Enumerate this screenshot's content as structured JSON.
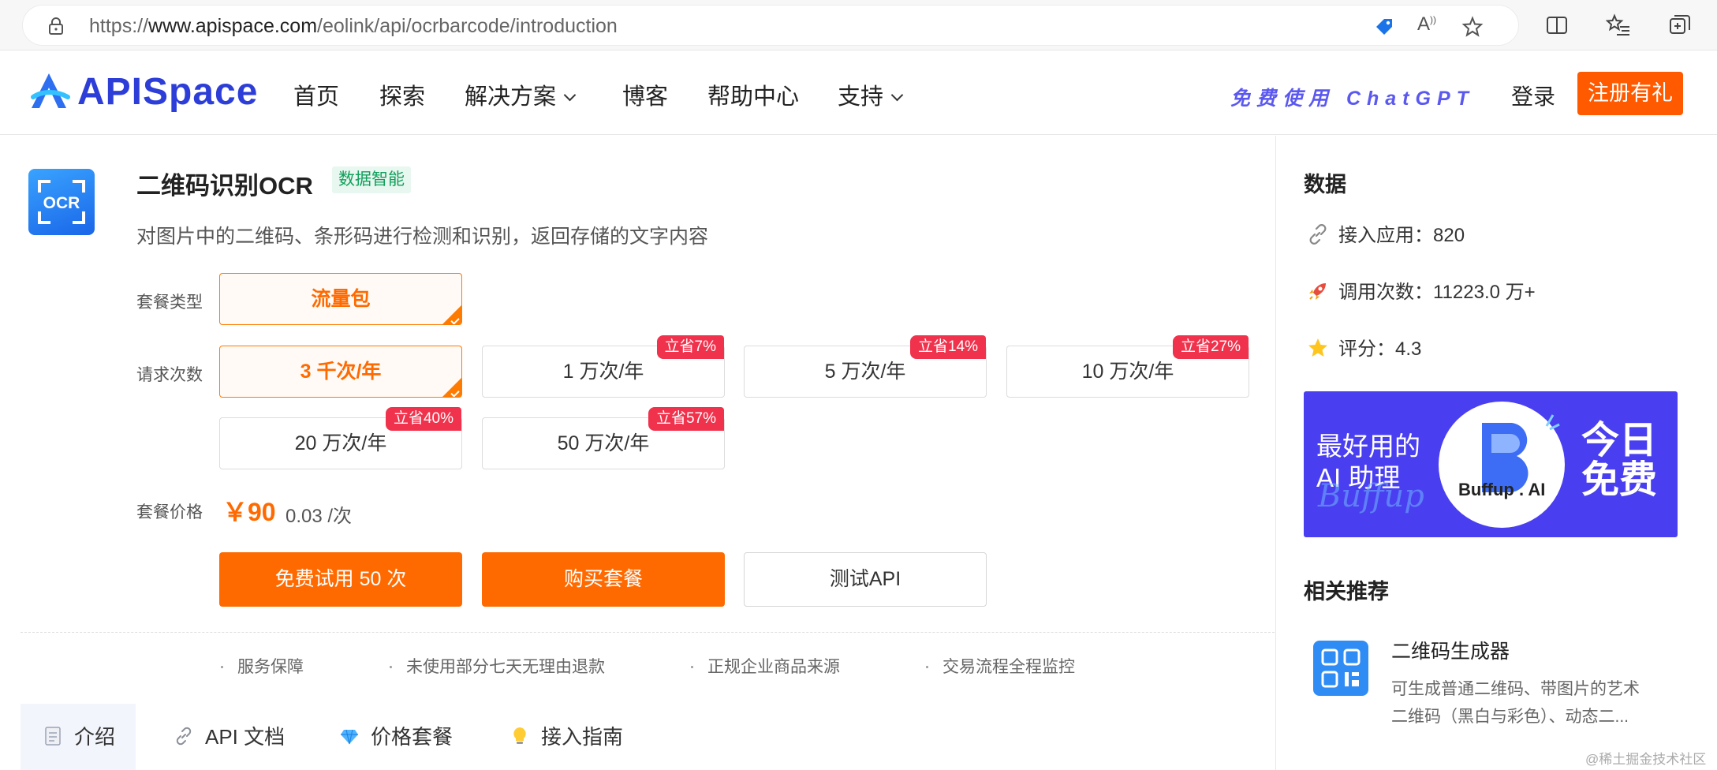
{
  "browser": {
    "url_prefix": "https://",
    "url_domain": "www.apispace.com",
    "url_path": "/eolink/api/ocrbarcode/introduction"
  },
  "nav": {
    "logo": "APISpace",
    "items": [
      "首页",
      "探索",
      "解决方案",
      "博客",
      "帮助中心",
      "支持"
    ],
    "promo": "免费使用 ChatGPT",
    "login": "登录",
    "register": "注册有礼"
  },
  "product": {
    "icon_text": "OCR",
    "title": "二维码识别OCR",
    "tag": "数据智能",
    "description": "对图片中的二维码、条形码进行检测和识别，返回存储的文字内容",
    "package_type_label": "套餐类型",
    "package_types": [
      {
        "label": "流量包",
        "selected": true
      }
    ],
    "request_label": "请求次数",
    "request_options": [
      {
        "label": "3 千次/年",
        "selected": true,
        "badge": ""
      },
      {
        "label": "1 万次/年",
        "selected": false,
        "badge": "立省7%"
      },
      {
        "label": "5 万次/年",
        "selected": false,
        "badge": "立省14%"
      },
      {
        "label": "10 万次/年",
        "selected": false,
        "badge": "立省27%"
      },
      {
        "label": "20 万次/年",
        "selected": false,
        "badge": "立省40%"
      },
      {
        "label": "50 万次/年",
        "selected": false,
        "badge": "立省57%"
      }
    ],
    "price_label": "套餐价格",
    "price": "￥90",
    "unit_price": "0.03 /次",
    "buttons": {
      "trial": "免费试用 50 次",
      "buy": "购买套餐",
      "test": "测试API"
    },
    "guarantees": [
      "服务保障",
      "未使用部分七天无理由退款",
      "正规企业商品来源",
      "交易流程全程监控"
    ],
    "tabs": [
      "介绍",
      "API 文档",
      "价格套餐",
      "接入指南"
    ]
  },
  "sidebar": {
    "data_title": "数据",
    "stats": [
      {
        "label": "接入应用：",
        "value": "820",
        "icon": "link-icon"
      },
      {
        "label": "调用次数：",
        "value": "11223.0 万+",
        "icon": "rocket-icon"
      },
      {
        "label": "评分：",
        "value": "4.3",
        "icon": "star-icon"
      }
    ],
    "banner": {
      "left_line1": "最好用的",
      "left_line2": "AI 助理",
      "script": "Buffup",
      "brand": "Buffup . AI",
      "right_line1": "今日",
      "right_line2": "免费"
    },
    "related_title": "相关推荐",
    "related": [
      {
        "title": "二维码生成器",
        "desc": "可生成普通二维码、带图片的艺术二维码（黑白与彩色）、动态二..."
      }
    ]
  },
  "watermark": "@稀土掘金技术社区",
  "colors": {
    "accent": "#ff6a00",
    "brand": "#2d3ed8",
    "badge": "#f0324c",
    "banner": "#4a3ff0"
  }
}
